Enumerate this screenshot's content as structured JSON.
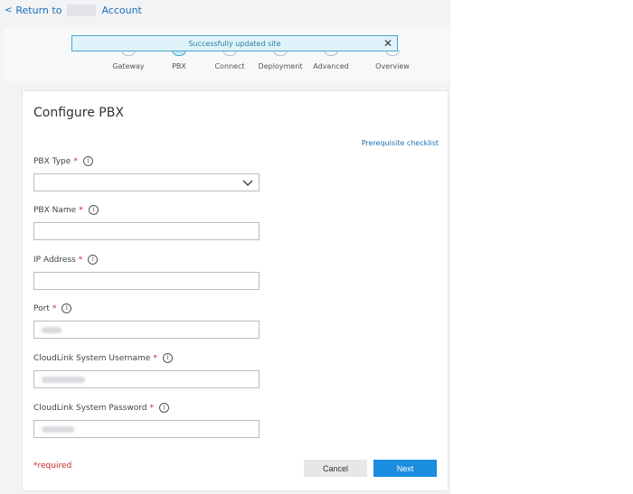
{
  "nav": {
    "back_prefix": "Return to",
    "back_suffix": "Account"
  },
  "toast": {
    "message": "Successfully updated site"
  },
  "steps": [
    "Gateway",
    "PBX",
    "Connect",
    "Deployment",
    "Advanced",
    "Overview"
  ],
  "form": {
    "title": "Configure PBX",
    "prereq_link": "Prerequisite checklist",
    "fields": {
      "pbx_type": {
        "label": "PBX Type",
        "value": ""
      },
      "pbx_name": {
        "label": "PBX Name",
        "value": ""
      },
      "ip_address": {
        "label": "IP Address",
        "value": ""
      },
      "port": {
        "label": "Port"
      },
      "username": {
        "label": "CloudLink System Username"
      },
      "password": {
        "label": "CloudLink System Password"
      }
    },
    "required_mark": "*",
    "info_glyph": "i",
    "required_note": "*required"
  },
  "buttons": {
    "cancel": "Cancel",
    "next": "Next"
  },
  "colors": {
    "accent": "#1a8de0",
    "link": "#1a6fb5",
    "required": "#c62828",
    "toast_bg": "#dff3fa"
  }
}
